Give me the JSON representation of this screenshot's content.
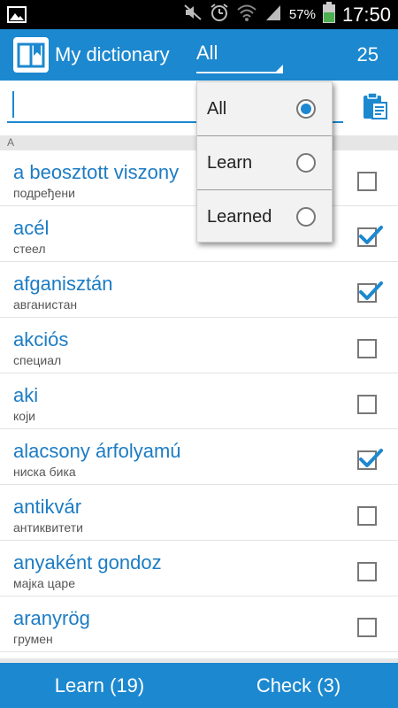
{
  "status_bar": {
    "battery_percent": "57%",
    "time": "17:50",
    "icons": [
      "image-icon",
      "mute-icon",
      "alarm-icon",
      "wifi-icon",
      "signal-icon",
      "battery-icon"
    ]
  },
  "app_bar": {
    "title": "My dictionary",
    "filter_value": "All",
    "count": "25"
  },
  "search": {
    "value": "",
    "placeholder": ""
  },
  "section_letter": "A",
  "words": [
    {
      "word": "a beosztott viszony",
      "translation": "подређени",
      "checked": false
    },
    {
      "word": "acél",
      "translation": "стеел",
      "checked": true
    },
    {
      "word": "afganisztán",
      "translation": "авганистан",
      "checked": true
    },
    {
      "word": "akciós",
      "translation": "специал",
      "checked": false
    },
    {
      "word": "aki",
      "translation": "који",
      "checked": false
    },
    {
      "word": "alacsony árfolyamú",
      "translation": "ниска бика",
      "checked": true
    },
    {
      "word": "antikvár",
      "translation": "антиквитети",
      "checked": false
    },
    {
      "word": "anyaként gondoz",
      "translation": "мајка царе",
      "checked": false
    },
    {
      "word": "aranyrög",
      "translation": "грумен",
      "checked": false
    }
  ],
  "dropdown": {
    "options": [
      {
        "label": "All",
        "selected": true
      },
      {
        "label": "Learn",
        "selected": false
      },
      {
        "label": "Learned",
        "selected": false
      }
    ]
  },
  "bottom_bar": {
    "learn_label": "Learn (19)",
    "check_label": "Check (3)"
  },
  "colors": {
    "accent": "#1c88cf",
    "word_text": "#1c7cc4",
    "status_bar": "#000000"
  }
}
